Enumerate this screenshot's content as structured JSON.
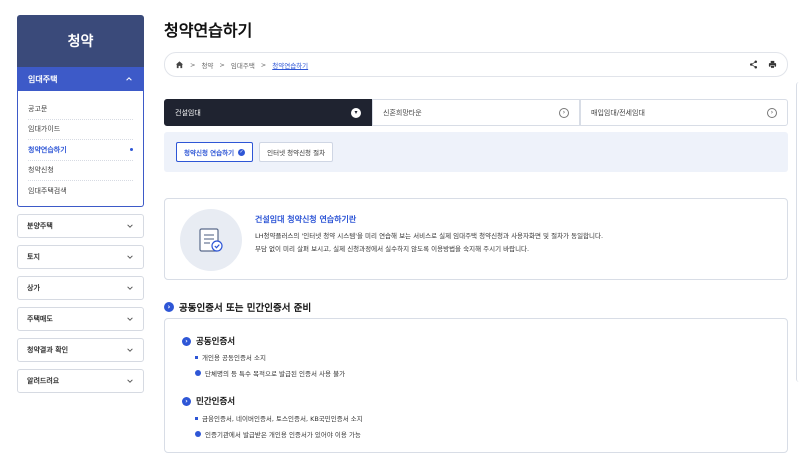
{
  "sidebar": {
    "title": "청약",
    "group": {
      "label": "임대주택",
      "items": [
        {
          "label": "공고문",
          "active": false
        },
        {
          "label": "임대가이드",
          "active": false
        },
        {
          "label": "청약연습하기",
          "active": true
        },
        {
          "label": "청약신청",
          "active": false
        },
        {
          "label": "임대주택검색",
          "active": false
        }
      ]
    },
    "menus": [
      "분양주택",
      "토지",
      "상가",
      "주택매도",
      "청약결과 확인",
      "알려드려요"
    ]
  },
  "page": {
    "title": "청약연습하기"
  },
  "breadcrumb": {
    "items": [
      "청약",
      "임대주택",
      "청약연습하기"
    ]
  },
  "tabs": [
    {
      "label": "건설임대",
      "active": true
    },
    {
      "label": "신혼희망타운",
      "active": false
    },
    {
      "label": "매입임대/전세임대",
      "active": false
    }
  ],
  "subtabs": [
    {
      "label": "청약신청 연습하기",
      "active": true
    },
    {
      "label": "인터넷 청약신청 절차",
      "active": false
    }
  ],
  "intro": {
    "title": "건설임대 청약신청 연습하기란",
    "line1": "LH청약플러스의 '인터넷 청약 시스템'을 미리 연습해 보는 서비스로 실제 임대주택 청약신청과 사용자화면 및 절차가 동일합니다.",
    "line2": "부담 없이 미리 살펴 보시고, 실제 신청과정에서 실수하지 않도록 이용방법을 숙지해 주시기 바랍니다."
  },
  "section": {
    "title": "공동인증서 또는 민간인증서 준비"
  },
  "certs": [
    {
      "heading": "공동인증서",
      "items": [
        {
          "text": "개인용 공동인증서 소지",
          "type": "square"
        },
        {
          "text": "단체명의 등 특수 목적으로 발급된 인증서 사용 불가",
          "type": "info"
        }
      ]
    },
    {
      "heading": "민간인증서",
      "items": [
        {
          "text": "금융인증서, 네이버인증서, 토스인증서, KB국민인증서 소지",
          "type": "square"
        },
        {
          "text": "인증기관에서 발급받은 개인용 인증서가 있어야 이용 가능",
          "type": "info"
        }
      ]
    }
  ],
  "colors": {
    "accent": "#2e56d6",
    "sidebar_header": "#3a4a7a",
    "active_tab": "#1f2330"
  }
}
